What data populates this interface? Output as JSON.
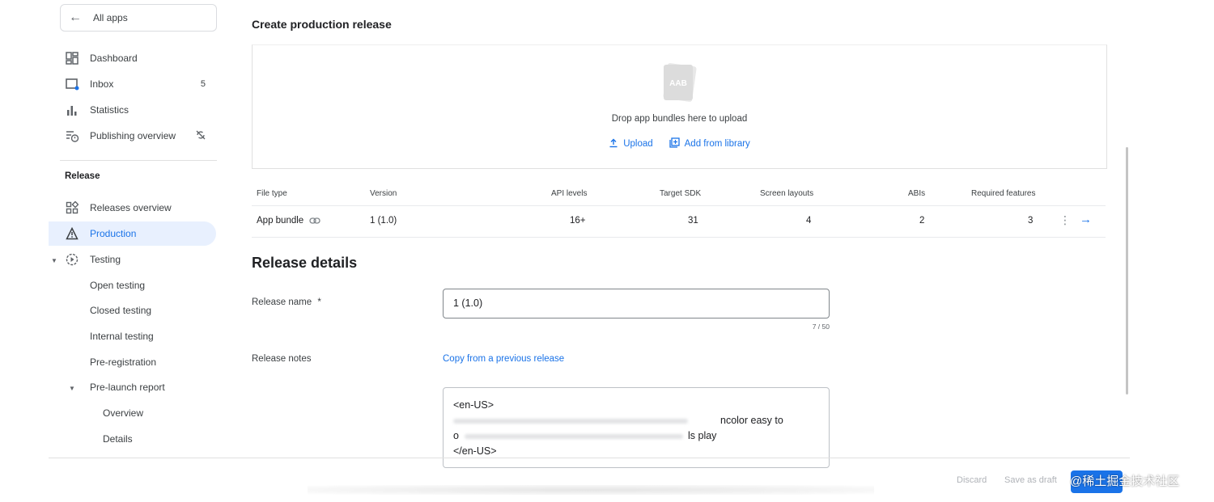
{
  "sidebar": {
    "all_apps": "All apps",
    "items": [
      {
        "label": "Dashboard",
        "icon": "dashboard-icon"
      },
      {
        "label": "Inbox",
        "icon": "inbox-icon",
        "count": "5"
      },
      {
        "label": "Statistics",
        "icon": "statistics-icon"
      },
      {
        "label": "Publishing overview",
        "icon": "publishing-overview-icon"
      }
    ],
    "section_release": "Release",
    "release_items": [
      {
        "label": "Releases overview"
      },
      {
        "label": "Production"
      },
      {
        "label": "Testing"
      },
      {
        "label": "Open testing"
      },
      {
        "label": "Closed testing"
      },
      {
        "label": "Internal testing"
      },
      {
        "label": "Pre-registration"
      },
      {
        "label": "Pre-launch report"
      },
      {
        "label": "Overview"
      },
      {
        "label": "Details"
      }
    ]
  },
  "main": {
    "title": "Create production release",
    "drop": {
      "aab_text": "AAB",
      "text": "Drop app bundles here to upload",
      "upload": "Upload",
      "add_from_library": "Add from library"
    },
    "table": {
      "headers": [
        "File type",
        "Version",
        "API levels",
        "Target SDK",
        "Screen layouts",
        "ABIs",
        "Required features"
      ],
      "row": [
        "App bundle",
        "1 (1.0)",
        "16+",
        "31",
        "4",
        "2",
        "3"
      ]
    },
    "details": {
      "title": "Release details",
      "release_name_label": "Release name",
      "required_mark": "*",
      "release_name_value": "1 (1.0)",
      "counter": "7 / 50",
      "release_notes_label": "Release notes",
      "copy_link": "Copy from a previous release",
      "notes_open": "<en-US>",
      "notes_line2_end": "ncolor easy to",
      "notes_line3_start": "o",
      "notes_line3_end": "ls play",
      "notes_close": "</en-US>"
    }
  },
  "footer": {
    "discard": "Discard",
    "save_draft": "Save as draft",
    "watermark": "@稀土掘金技术社区"
  },
  "colors": {
    "accent": "#1a73e8",
    "active_bg": "#e8f0fe"
  }
}
